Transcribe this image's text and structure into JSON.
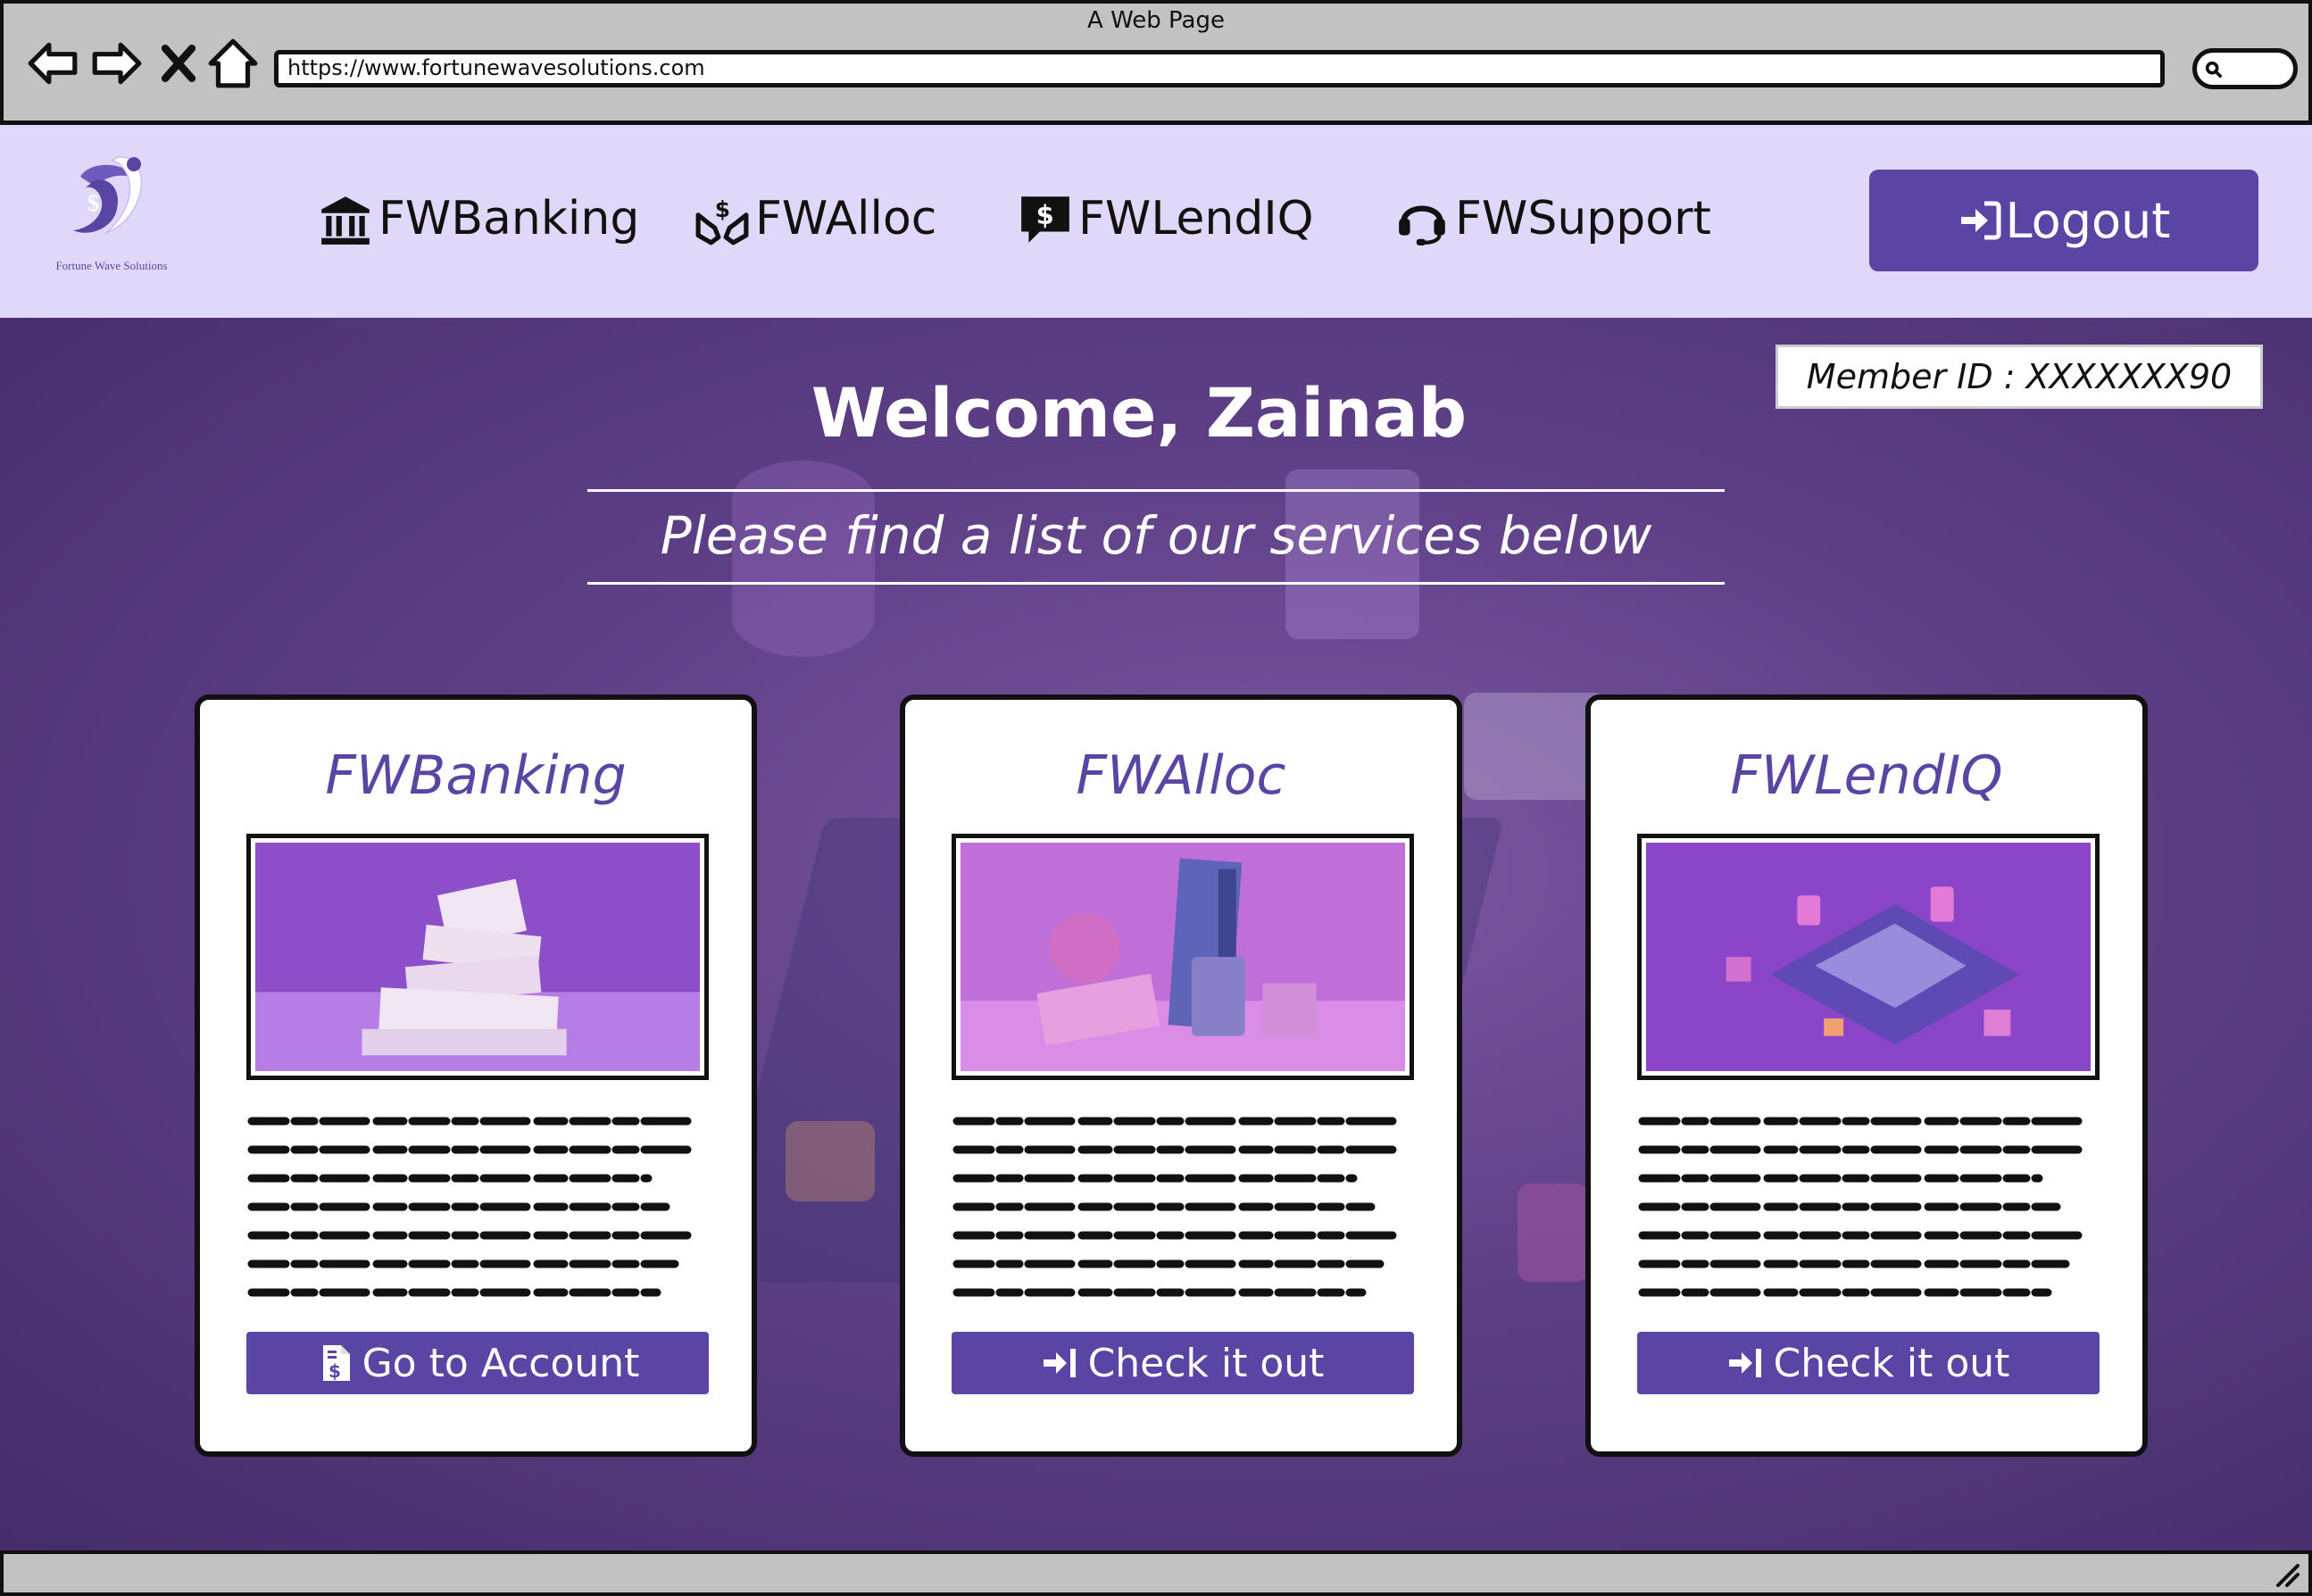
{
  "window": {
    "title": "A Web Page"
  },
  "browser": {
    "url": "https://www.fortunewavesolutions.com",
    "icons": [
      "back-arrow-icon",
      "forward-arrow-icon",
      "close-x-icon",
      "home-icon",
      "search-icon"
    ]
  },
  "header": {
    "logo_text": "Fortune Wave Solutions",
    "nav": [
      {
        "label": "FWBanking",
        "icon": "bank-icon"
      },
      {
        "label": "FWAlloc",
        "icon": "hands-dollar-icon"
      },
      {
        "label": "FWLendIQ",
        "icon": "dollar-message-icon"
      },
      {
        "label": "FWSupport",
        "icon": "headset-icon"
      }
    ],
    "logout_label": "Logout"
  },
  "main": {
    "member_id": "Member ID : XXXXXXX90",
    "welcome": "Welcome, Zainab",
    "subtitle": "Please find a list of our services below",
    "cards": [
      {
        "title": "FWBanking",
        "button": "Go to Account",
        "button_icon": "invoice-dollar-icon",
        "image": "money-stack-image"
      },
      {
        "title": "FWAlloc",
        "button": "Check it out",
        "button_icon": "sign-in-icon",
        "image": "finance-objects-image"
      },
      {
        "title": "FWLendIQ",
        "button": "Check it out",
        "button_icon": "sign-in-icon",
        "image": "calculator-image"
      }
    ]
  },
  "colors": {
    "accent": "#5a44a4",
    "header_bg": "#e0d8f8",
    "main_bg": "#5d3f86",
    "chrome_bg": "#c2c2c2"
  }
}
